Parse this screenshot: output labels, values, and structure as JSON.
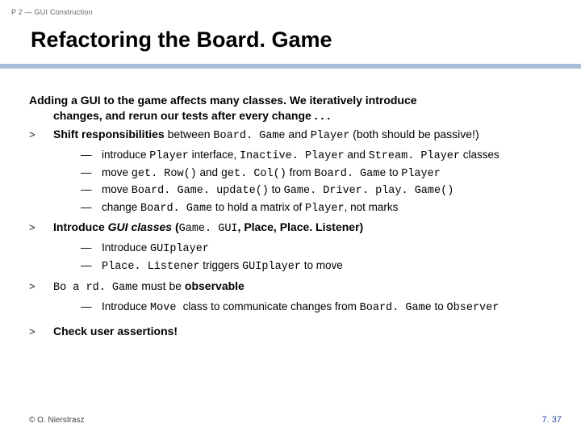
{
  "breadcrumb": "P 2 — GUI Construction",
  "title": "Refactoring the Board. Game",
  "intro_line1": "Adding a GUI to the game affects many classes. We iteratively introduce",
  "intro_line2": "changes, and rerun our tests after every change . . .",
  "bullet_marker": ">",
  "dash_marker": "—",
  "p1": {
    "pre": "Shift responsibilities",
    "mid1": " between ",
    "code1": "Board. Game",
    "mid2": " and ",
    "code2": "Player",
    "post": " (both should be passive!)"
  },
  "p1sub": {
    "a": {
      "t0": "introduce ",
      "c1": "Player",
      "t1": " interface, ",
      "c2": "Inactive. Player",
      "t2": " and ",
      "c3": "Stream. Player",
      "t3": " classes"
    },
    "b": {
      "t0": "move ",
      "c1": "get. Row()",
      "t1": " and ",
      "c2": "get. Col()",
      "t2": " from ",
      "c3": "Board. Game",
      "t3": " to ",
      "c4": "Player"
    },
    "c": {
      "t0": "move ",
      "c1": "Board. Game. update()",
      "t1": " to ",
      "c2": "Game. Driver. play. Game()"
    },
    "d": {
      "t0": "change ",
      "c1": "Board. Game",
      "t1": " to hold a matrix of ",
      "c2": "Player",
      "t2": ", not marks"
    }
  },
  "p2": {
    "pre": "Introduce ",
    "mid": "GUI classes",
    "open": " (",
    "c1": "Game. GUI",
    "sep1": ", Place, Place. Listener)",
    "all_bold": true
  },
  "p2sub": {
    "a": {
      "t0": "Introduce ",
      "c1": "GUIplayer"
    },
    "b": {
      "c1": "Place. Listener",
      "t1": " triggers ",
      "c2": "GUIplayer",
      "t2": " to move"
    }
  },
  "p3": {
    "c1": "Bo a rd. Game",
    "t1": " must be ",
    "b1": "observable"
  },
  "p3sub": {
    "a": {
      "t0": "Introduce ",
      "c1": "Move ",
      "t1": " class to communicate changes from ",
      "c2": "Board. Game",
      "t2": " to ",
      "c3": "Observer"
    }
  },
  "p4": "Check user assertions!",
  "footer_left": "© O. Nierstrasz",
  "footer_right": "7. 37"
}
